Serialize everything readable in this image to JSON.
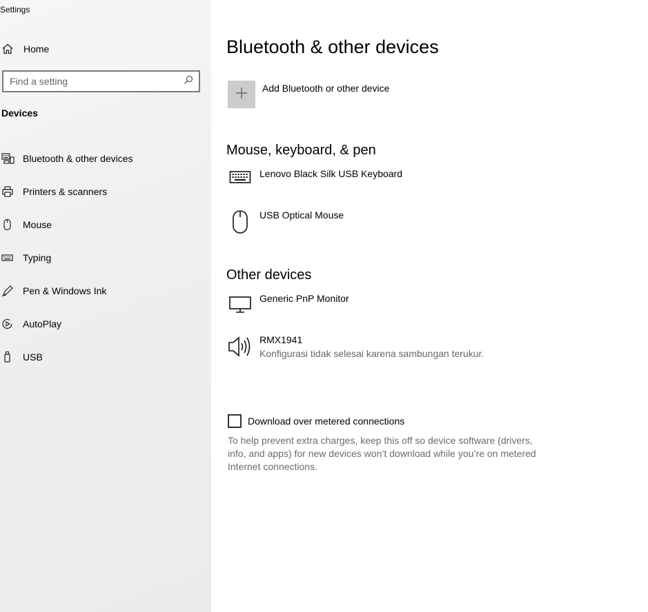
{
  "window": {
    "title": "Settings"
  },
  "sidebar": {
    "home_label": "Home",
    "search_placeholder": "Find a setting",
    "section_title": "Devices",
    "items": [
      {
        "label": "Bluetooth & other devices",
        "icon": "bluetooth-devices-icon"
      },
      {
        "label": "Printers & scanners",
        "icon": "printer-icon"
      },
      {
        "label": "Mouse",
        "icon": "mouse-icon"
      },
      {
        "label": "Typing",
        "icon": "keyboard-icon"
      },
      {
        "label": "Pen & Windows Ink",
        "icon": "pen-icon"
      },
      {
        "label": "AutoPlay",
        "icon": "autoplay-icon"
      },
      {
        "label": "USB",
        "icon": "usb-icon"
      }
    ]
  },
  "main": {
    "title": "Bluetooth & other devices",
    "add_device_label": "Add Bluetooth or other device",
    "groups": [
      {
        "title": "Mouse, keyboard, & pen",
        "devices": [
          {
            "name": "Lenovo Black Silk USB Keyboard",
            "icon": "keyboard-icon"
          },
          {
            "name": "USB Optical Mouse",
            "icon": "mouse-icon"
          }
        ]
      },
      {
        "title": "Other devices",
        "devices": [
          {
            "name": "Generic PnP Monitor",
            "icon": "monitor-icon"
          },
          {
            "name": "RMX1941",
            "status": "Konfigurasi tidak selesai karena sambungan terukur.",
            "icon": "speaker-icon"
          }
        ]
      }
    ],
    "metered": {
      "label": "Download over metered connections",
      "checked": false,
      "help": "To help prevent extra charges, keep this off so device software (drivers, info, and apps) for new devices won’t download while you’re on metered Internet connections."
    }
  },
  "colors": {
    "sidebar_bg": "#efefef",
    "add_tile_bg": "#cccccc",
    "secondary_text": "#666666"
  }
}
